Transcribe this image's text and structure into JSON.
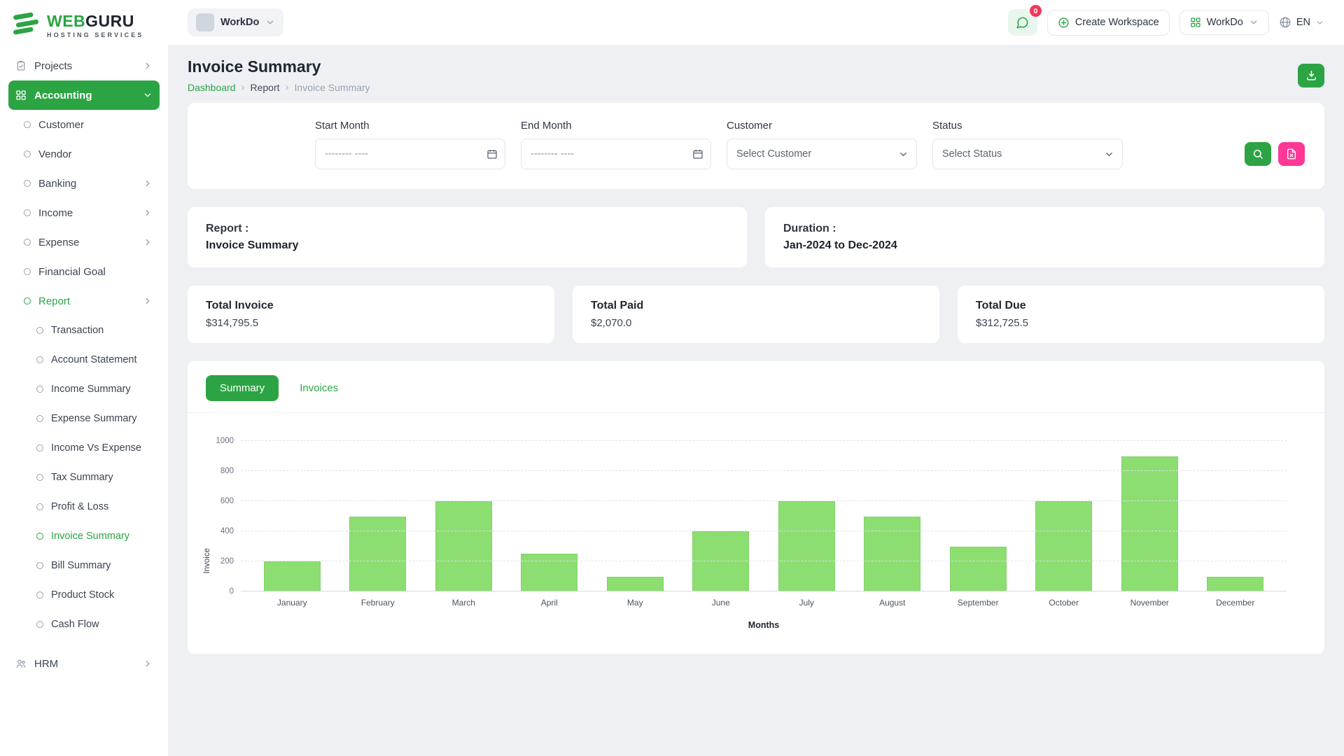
{
  "brand": {
    "name_web": "WEB",
    "name_guru": "GURU",
    "tagline": "HOSTING SERVICES"
  },
  "topbar": {
    "workspace_chip_label": "WorkDo",
    "messages_badge": "0",
    "create_workspace_label": "Create Workspace",
    "workspace_menu_label": "WorkDo",
    "language": "EN"
  },
  "sidebar": {
    "items": [
      {
        "label": "Projects",
        "level": 0,
        "icon": "clipboard",
        "chevron": "right"
      },
      {
        "label": "Accounting",
        "level": 0,
        "icon": "grid",
        "chevron": "down",
        "active": true
      },
      {
        "label": "Customer",
        "level": 1,
        "icon": "ring"
      },
      {
        "label": "Vendor",
        "level": 1,
        "icon": "ring"
      },
      {
        "label": "Banking",
        "level": 1,
        "icon": "ring",
        "chevron": "right"
      },
      {
        "label": "Income",
        "level": 1,
        "icon": "ring",
        "chevron": "right"
      },
      {
        "label": "Expense",
        "level": 1,
        "icon": "ring",
        "chevron": "right"
      },
      {
        "label": "Financial Goal",
        "level": 1,
        "icon": "ring"
      },
      {
        "label": "Report",
        "level": 1,
        "icon": "ring",
        "chevron": "right",
        "highlight": true
      },
      {
        "label": "Transaction",
        "level": 2,
        "icon": "ring"
      },
      {
        "label": "Account Statement",
        "level": 2,
        "icon": "ring"
      },
      {
        "label": "Income Summary",
        "level": 2,
        "icon": "ring"
      },
      {
        "label": "Expense Summary",
        "level": 2,
        "icon": "ring"
      },
      {
        "label": "Income Vs Expense",
        "level": 2,
        "icon": "ring"
      },
      {
        "label": "Tax Summary",
        "level": 2,
        "icon": "ring"
      },
      {
        "label": "Profit & Loss",
        "level": 2,
        "icon": "ring"
      },
      {
        "label": "Invoice Summary",
        "level": 2,
        "icon": "ring",
        "highlight": true
      },
      {
        "label": "Bill Summary",
        "level": 2,
        "icon": "ring"
      },
      {
        "label": "Product Stock",
        "level": 2,
        "icon": "ring"
      },
      {
        "label": "Cash Flow",
        "level": 2,
        "icon": "ring"
      },
      {
        "label": "HRM",
        "level": 0,
        "icon": "users",
        "chevron": "right",
        "top_gap": true
      }
    ]
  },
  "page": {
    "title": "Invoice Summary",
    "breadcrumb": [
      "Dashboard",
      "Report",
      "Invoice Summary"
    ]
  },
  "filters": {
    "start_month_label": "Start Month",
    "end_month_label": "End Month",
    "customer_label": "Customer",
    "status_label": "Status",
    "date_placeholder": "-------- ----",
    "customer_value": "Select Customer",
    "status_value": "Select Status"
  },
  "summary_cards": {
    "report_label": "Report :",
    "report_value": "Invoice Summary",
    "duration_label": "Duration :",
    "duration_value": "Jan-2024 to Dec-2024"
  },
  "totals": [
    {
      "label": "Total Invoice",
      "value": "$314,795.5"
    },
    {
      "label": "Total Paid",
      "value": "$2,070.0"
    },
    {
      "label": "Total Due",
      "value": "$312,725.5"
    }
  ],
  "tabs": [
    {
      "label": "Summary",
      "active": true
    },
    {
      "label": "Invoices",
      "active": false
    }
  ],
  "chart_data": {
    "type": "bar",
    "categories": [
      "January",
      "February",
      "March",
      "April",
      "May",
      "June",
      "July",
      "August",
      "September",
      "October",
      "November",
      "December"
    ],
    "values": [
      200,
      500,
      600,
      250,
      100,
      400,
      600,
      500,
      300,
      600,
      900,
      100
    ],
    "title": "",
    "xlabel": "Months",
    "ylabel": "Invoice",
    "ylim": [
      0,
      1000
    ],
    "yticks": [
      0,
      200,
      400,
      600,
      800,
      1000
    ],
    "grid": true,
    "legend": false,
    "bar_color": "#8cde71"
  },
  "colors": {
    "accent": "#2ca444",
    "pink": "#fd3995",
    "badge": "#f5365c",
    "bar": "#8cde71"
  }
}
